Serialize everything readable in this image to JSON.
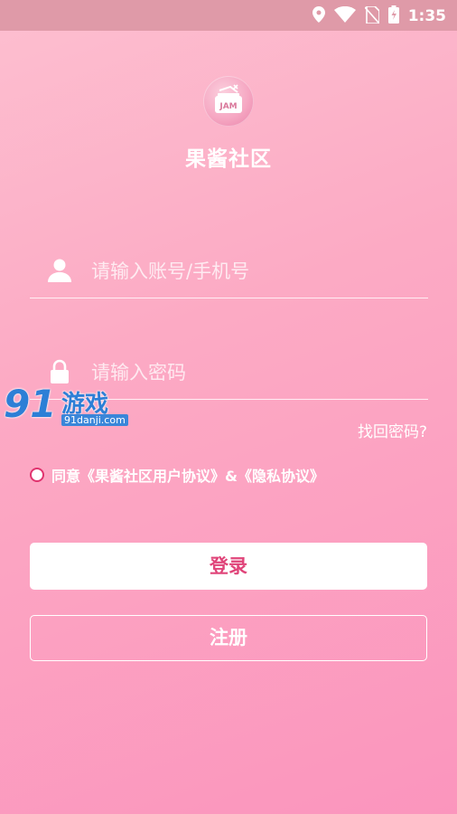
{
  "status_bar": {
    "time": "1:35",
    "icons": [
      "location-icon",
      "wifi-icon",
      "no-sim-icon",
      "battery-icon"
    ]
  },
  "app": {
    "logo_text": "JAM",
    "name": "果酱社区"
  },
  "form": {
    "account_placeholder": "请输入账号/手机号",
    "password_placeholder": "请输入密码",
    "forgot_password": "找回密码?",
    "agreement": "同意《果酱社区用户协议》&《隐私协议》",
    "login_label": "登录",
    "register_label": "注册"
  },
  "watermark": {
    "number": "91",
    "text": "游戏",
    "url": "91danji.com"
  },
  "colors": {
    "accent": "#e0457a",
    "watermark_blue": "#2d7fd6"
  }
}
